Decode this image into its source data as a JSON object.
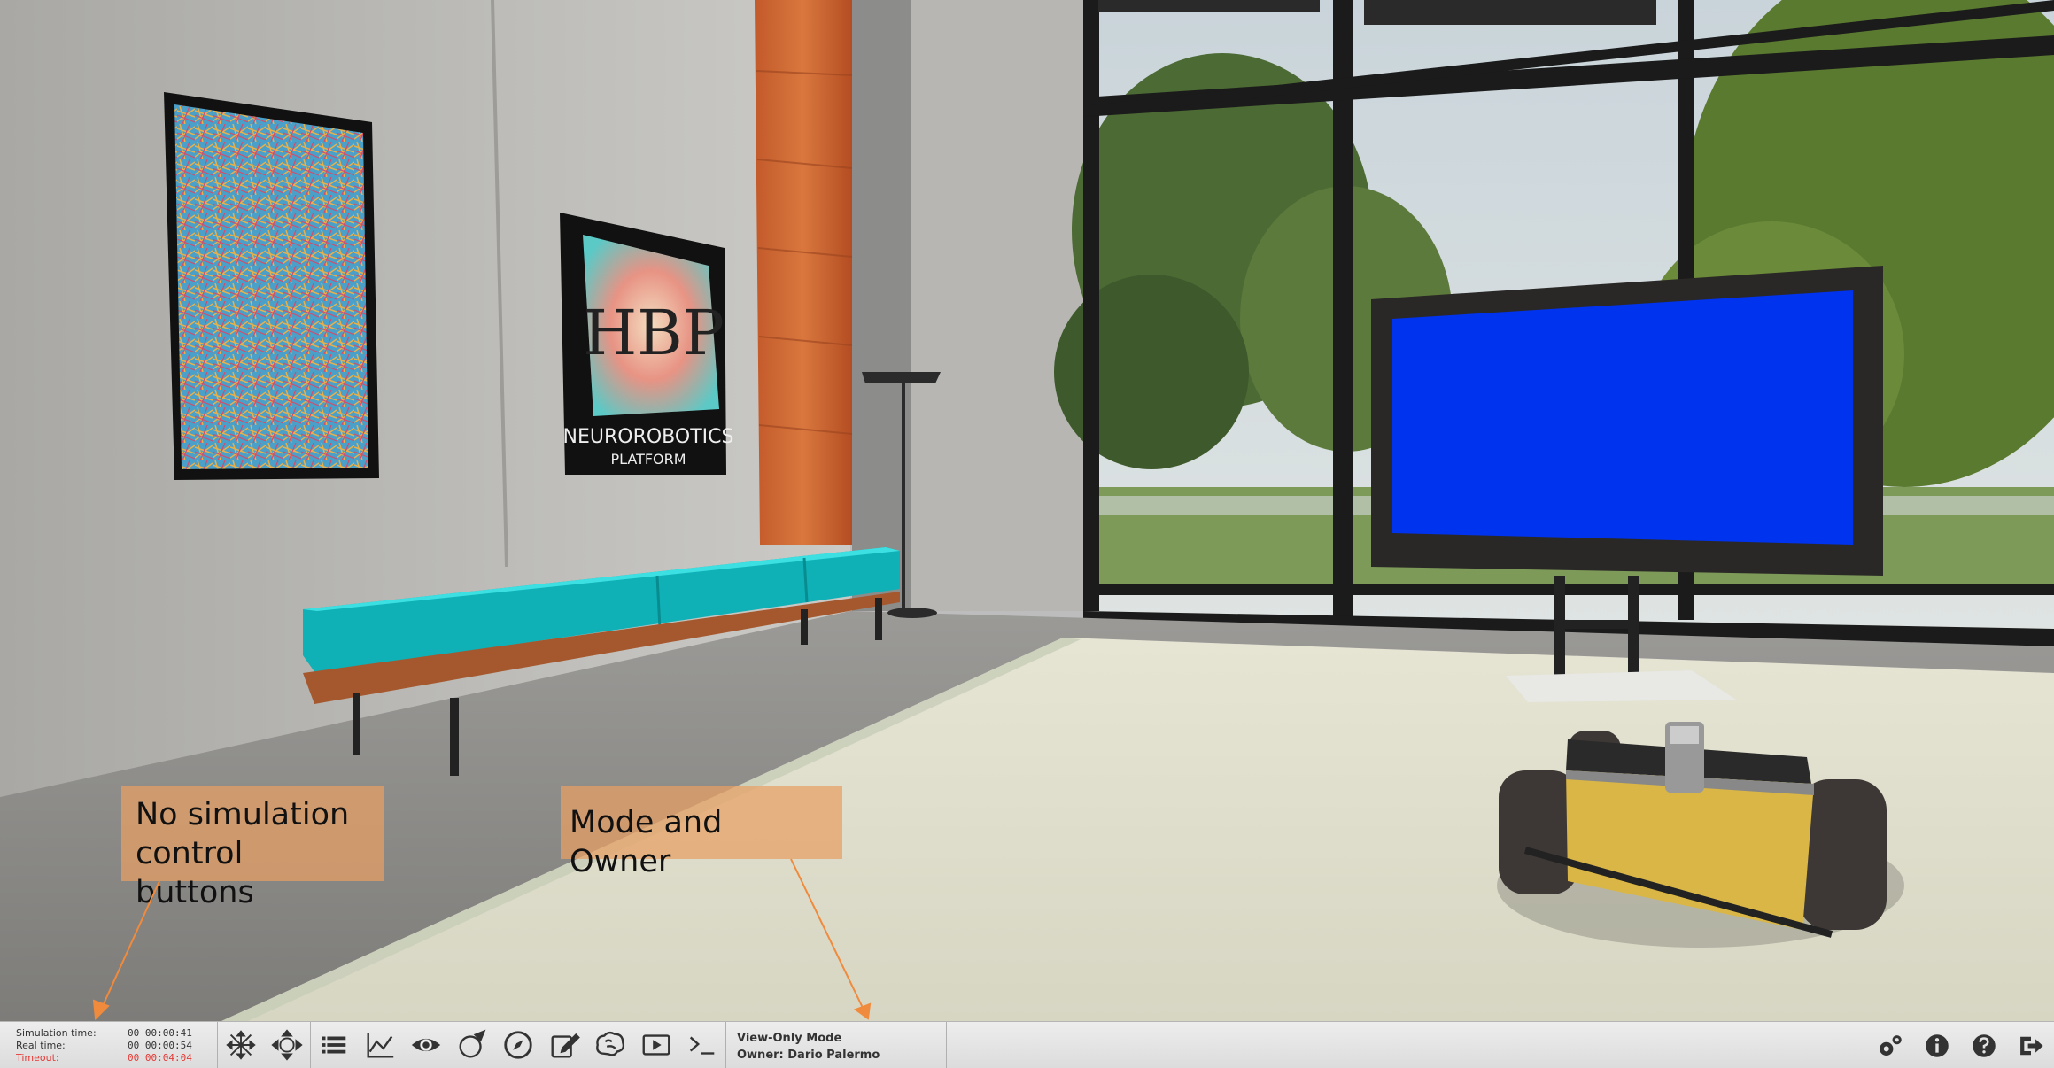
{
  "callouts": {
    "no_sim_line1": "No simulation",
    "no_sim_line2": "control buttons",
    "mode_owner": "Mode and Owner"
  },
  "poster": {
    "logo_text": "HBP",
    "line1": "NEUROROBOTICS",
    "line2": "PLATFORM"
  },
  "clock": {
    "sim_label": "Simulation time:",
    "sim_value": "00 00:00:41",
    "real_label": "Real time:",
    "real_value": "00 00:00:54",
    "timeout_label": "Timeout:",
    "timeout_value": "00 00:04:04"
  },
  "toolbar": {
    "tools": [
      {
        "name": "translate-object-icon"
      },
      {
        "name": "navigation-mode-icon"
      },
      {
        "name": "object-inspector-icon"
      },
      {
        "name": "brain-visualizer-chart-icon"
      },
      {
        "name": "view-toggle-eye-icon"
      },
      {
        "name": "environment-settings-icon"
      },
      {
        "name": "navigation-compass-icon"
      },
      {
        "name": "editor-icon"
      },
      {
        "name": "brain-icon"
      },
      {
        "name": "video-stream-icon"
      },
      {
        "name": "terminal-icon"
      }
    ],
    "mode": "View-Only Mode",
    "owner": "Owner: Dario Palermo",
    "right_tools": [
      {
        "name": "settings-gears-icon"
      },
      {
        "name": "info-icon"
      },
      {
        "name": "help-icon"
      },
      {
        "name": "exit-icon"
      }
    ]
  },
  "colors": {
    "wall": "#bdbcb8",
    "floor": "#8f8e8b",
    "bench": "#1cc4c8",
    "screen": "#0033ee",
    "callout": "#e8a064",
    "timeout": "#e53935"
  }
}
